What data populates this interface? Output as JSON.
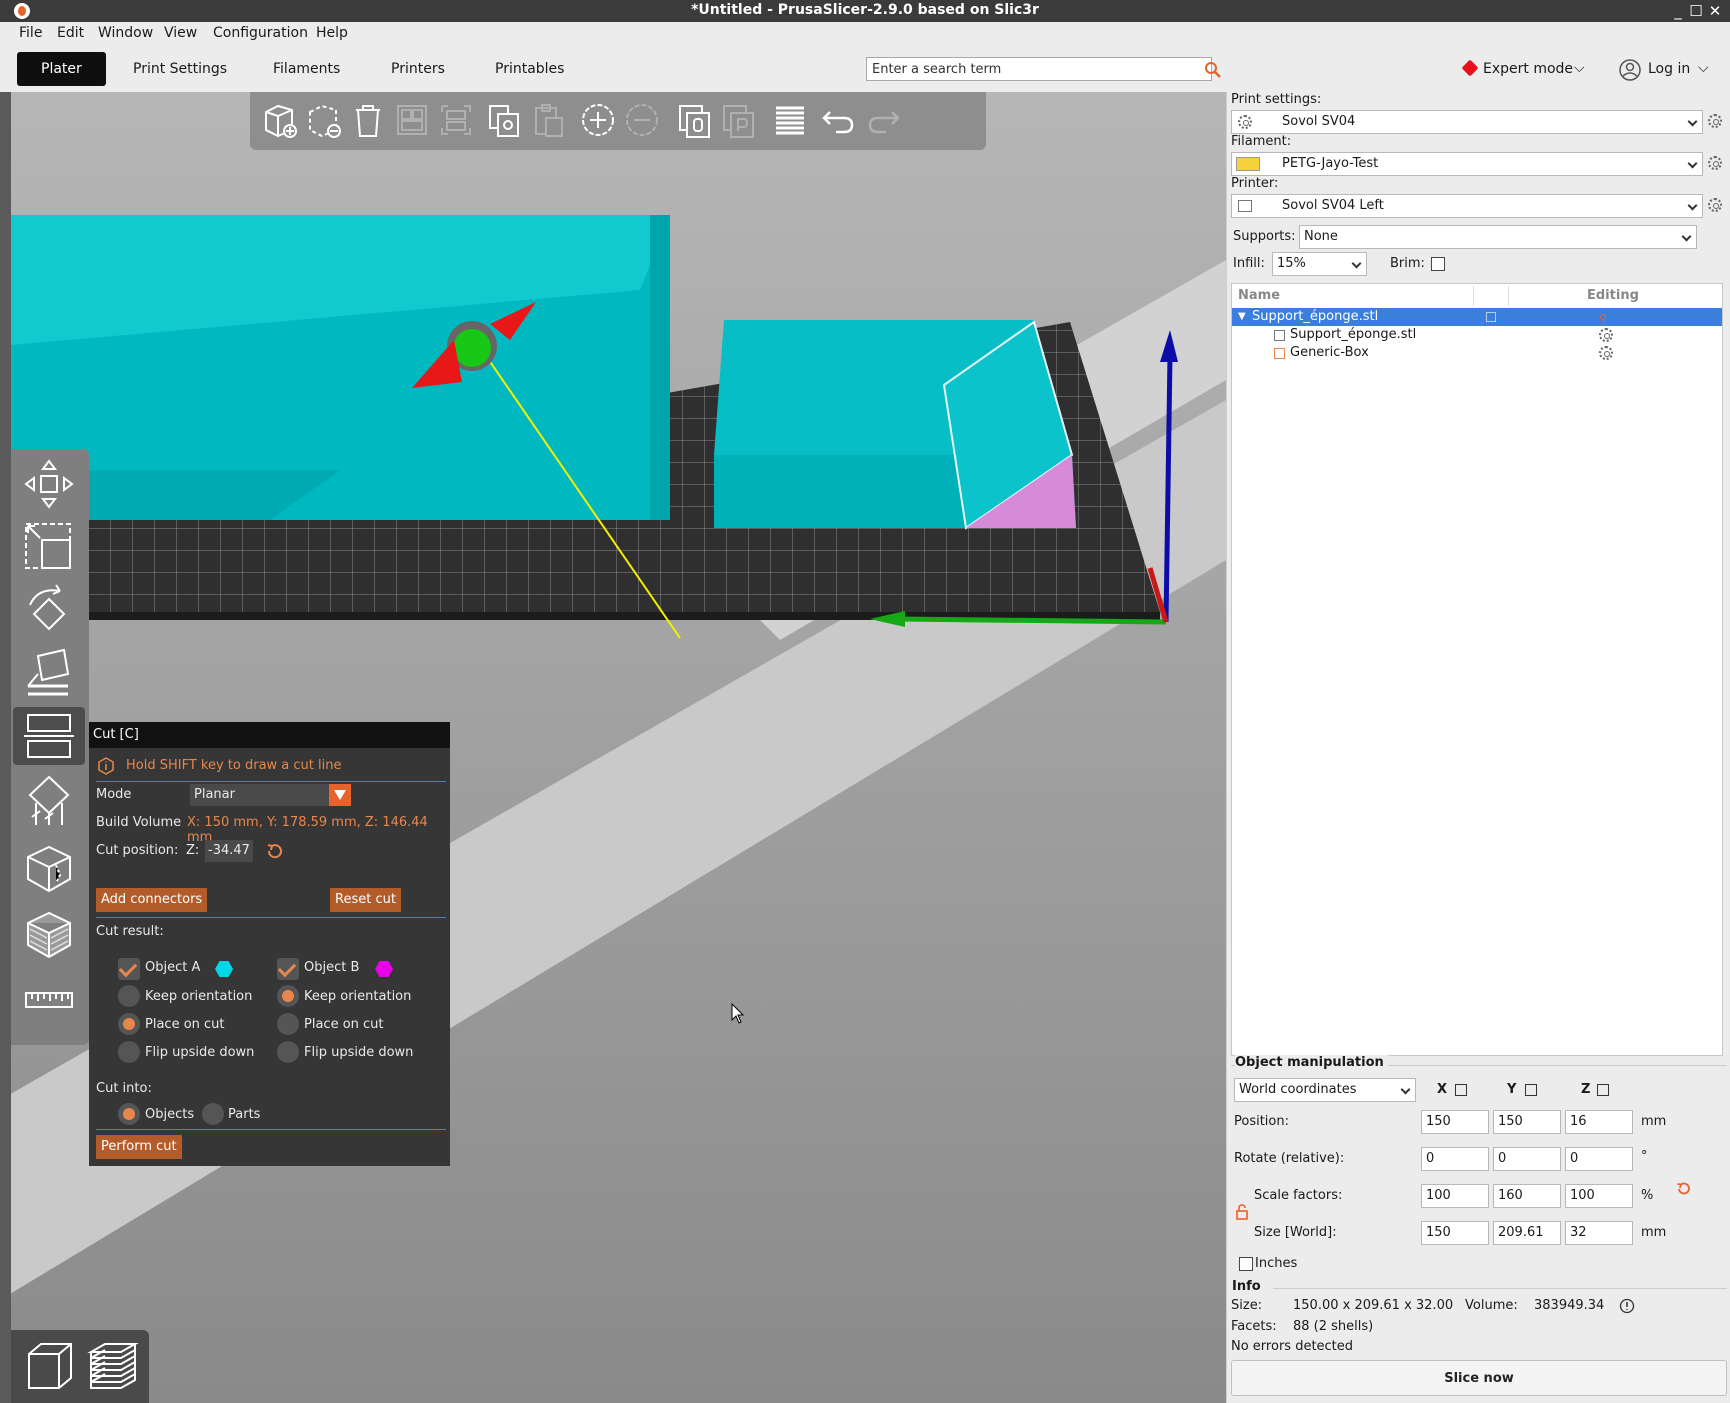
{
  "window": {
    "title": "*Untitled - PrusaSlicer-2.9.0 based on Slic3r"
  },
  "menu": [
    "File",
    "Edit",
    "Window",
    "View",
    "Configuration",
    "Help"
  ],
  "tabs": [
    "Plater",
    "Print Settings",
    "Filaments",
    "Printers",
    "Printables"
  ],
  "active_tab": "Plater",
  "search": {
    "placeholder": "Enter a search term"
  },
  "mode": {
    "label": "Expert mode",
    "color": "#e8101a"
  },
  "login": {
    "label": "Log in"
  },
  "cut_panel": {
    "title": "Cut [C]",
    "hint": "Hold SHIFT key to draw a cut line",
    "mode_label": "Mode",
    "mode_value": "Planar",
    "build_volume_label": "Build Volume",
    "build_volume_value": "X: 150 mm,  Y: 178.59 mm,  Z: 146.44 mm",
    "cut_position_label": "Cut position:",
    "cut_axis": "Z:",
    "cut_position_value": "-34.47",
    "add_connectors": "Add connectors",
    "reset_cut": "Reset cut",
    "cut_result_label": "Cut result:",
    "object_a": "Object A",
    "object_b": "Object B",
    "object_a_color": "#00d8e8",
    "object_b_color": "#e800e8",
    "keep_orientation": "Keep orientation",
    "place_on_cut": "Place on cut",
    "flip_upside_down": "Flip upside down",
    "cut_into_label": "Cut into:",
    "objects": "Objects",
    "parts": "Parts",
    "perform_cut": "Perform cut"
  },
  "sidebar": {
    "print_settings_label": "Print settings:",
    "print_settings_value": "Sovol SV04",
    "filament_label": "Filament:",
    "filament_value": "PETG-Jayo-Test",
    "filament_color": "#f5d23a",
    "printer_label": "Printer:",
    "printer_value": "Sovol SV04 Left",
    "supports_label": "Supports:",
    "supports_value": "None",
    "infill_label": "Infill:",
    "infill_value": "15%",
    "brim_label": "Brim:",
    "list_headers": {
      "name": "Name",
      "editing": "Editing"
    },
    "objects": [
      {
        "name": "Support_éponge.stl"
      },
      {
        "name": "Support_éponge.stl"
      },
      {
        "name": "Generic-Box"
      }
    ]
  },
  "object_manipulation": {
    "title": "Object manipulation",
    "coordinates": "World coordinates",
    "axes": [
      "X",
      "Y",
      "Z"
    ],
    "position_label": "Position:",
    "position": [
      "150",
      "150",
      "16"
    ],
    "position_unit": "mm",
    "rotate_label": "Rotate (relative):",
    "rotate": [
      "0",
      "0",
      "0"
    ],
    "rotate_unit": "°",
    "scale_label": "Scale factors:",
    "scale": [
      "100",
      "160",
      "100"
    ],
    "scale_unit": "%",
    "size_label": "Size [World]:",
    "size": [
      "150",
      "209.61",
      "32"
    ],
    "size_unit": "mm",
    "inches_label": "Inches"
  },
  "info": {
    "title": "Info",
    "size_label": "Size:",
    "size_value": "150.00 x 209.61 x 32.00",
    "volume_label": "Volume:",
    "volume_value": "383949.34",
    "facets_label": "Facets:",
    "facets_value": "88 (2 shells)",
    "status": "No errors detected"
  },
  "slice_button": "Slice now",
  "colors": {
    "accent": "#e8622c",
    "selection": "#3b7fdc",
    "model": "#00b8c0"
  }
}
